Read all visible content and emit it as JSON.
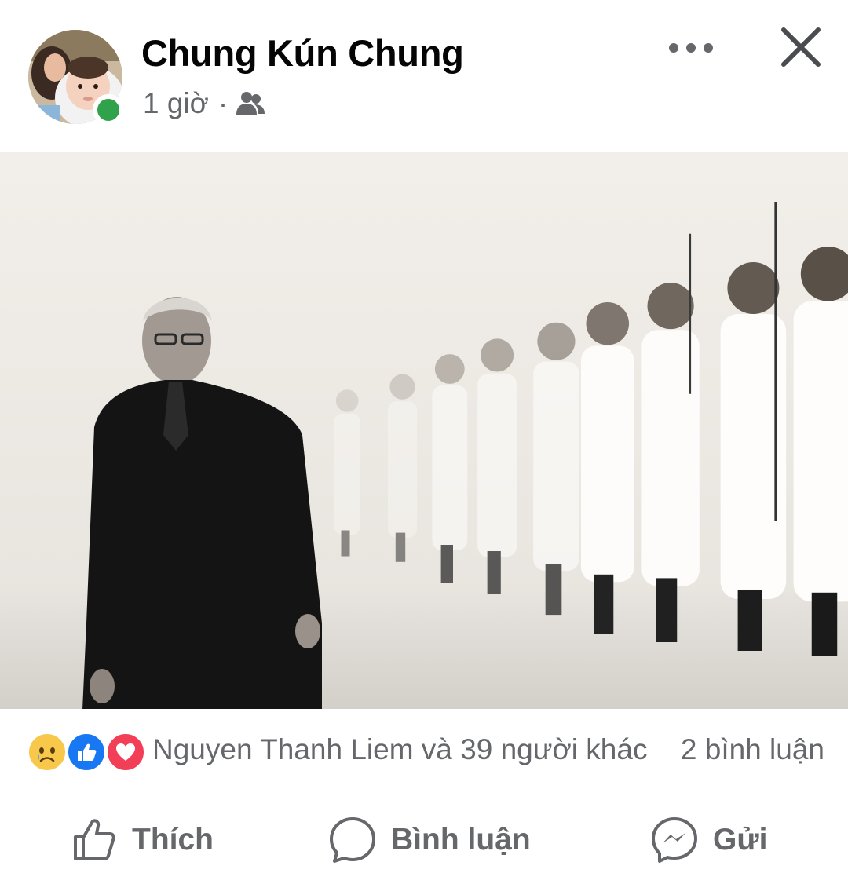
{
  "post": {
    "author_name": "Chung Kún Chung",
    "timestamp": "1 giờ",
    "separator": "·",
    "audience_icon": "friends-icon",
    "more_icon": "more-horizontal-icon",
    "close_icon": "close-icon",
    "online": true
  },
  "photo": {
    "alt": "Black and white photo"
  },
  "reactions": {
    "icons": [
      "sad-reaction-icon",
      "like-reaction-icon",
      "love-reaction-icon"
    ],
    "summary": "Nguyen Thanh Liem và 39 người khác",
    "comments": "2 bình luận"
  },
  "actions": {
    "like_label": "Thích",
    "comment_label": "Bình luận",
    "share_label": "Gửi"
  },
  "colors": {
    "online": "#31a24c",
    "like_blue": "#1877f2",
    "love_red": "#f33e58",
    "sad_yellow": "#f7c84a",
    "secondary_text": "#65676b"
  }
}
